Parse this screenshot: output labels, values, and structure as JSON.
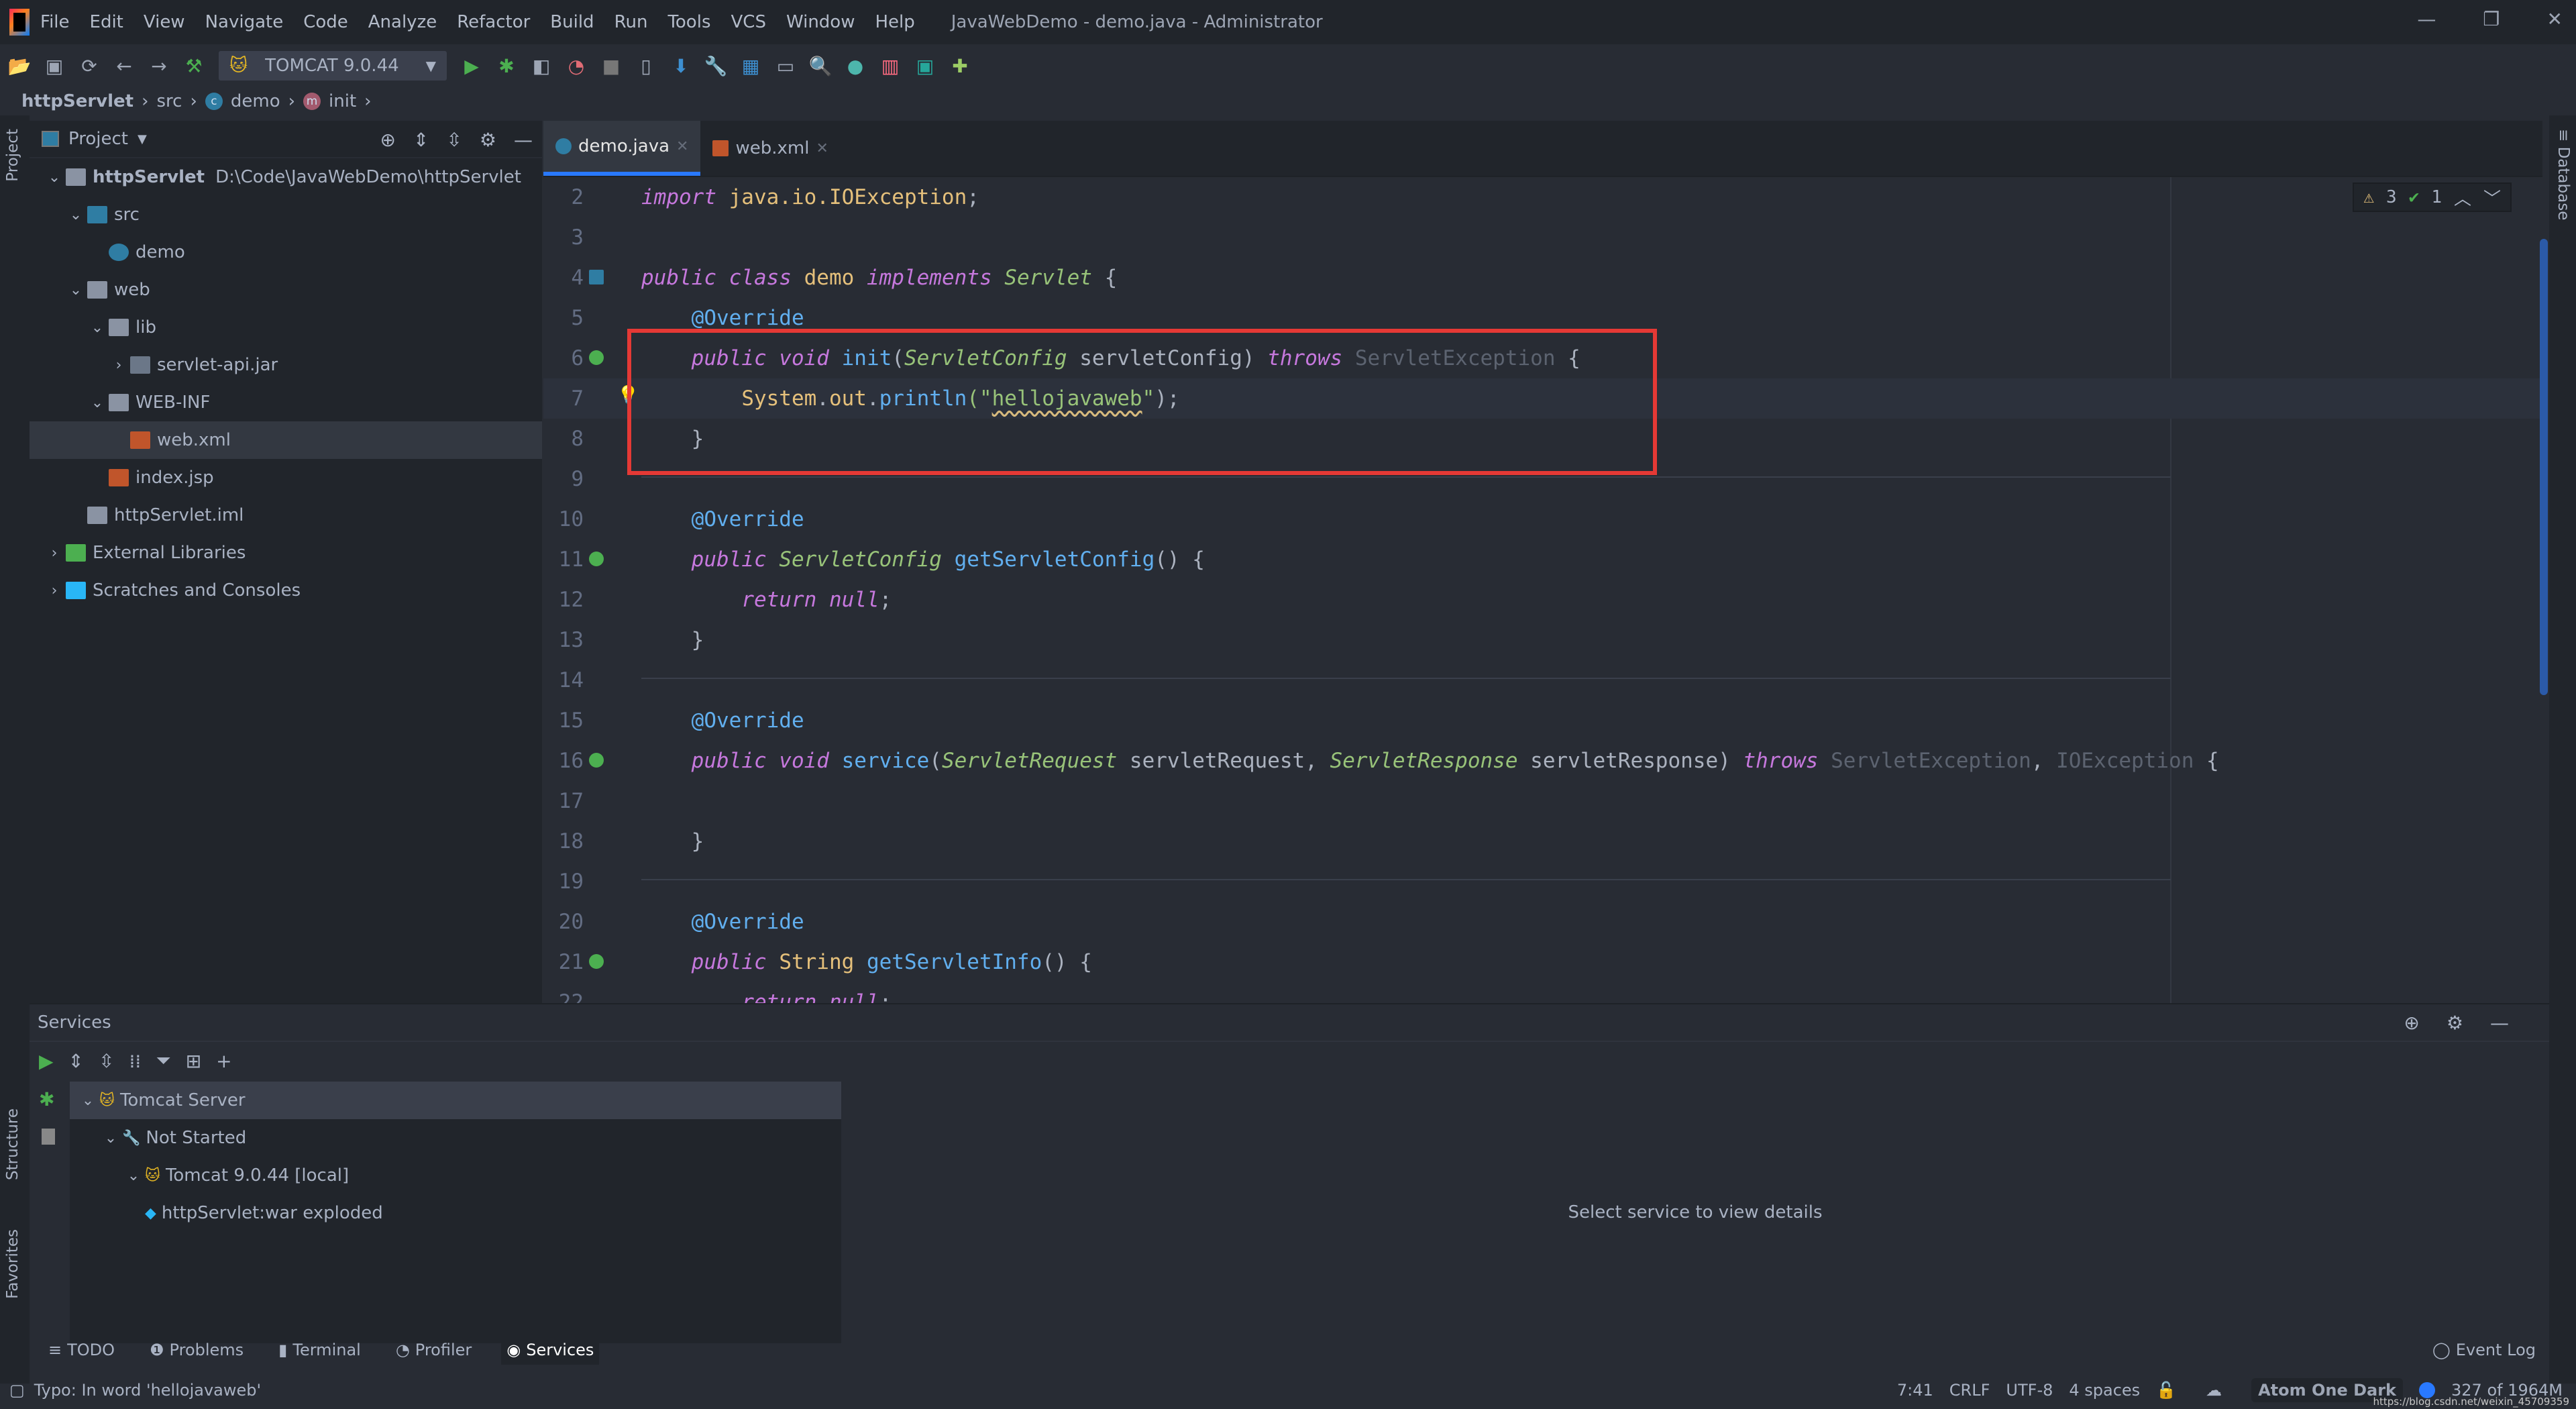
{
  "title_bar": {
    "menu": [
      "File",
      "Edit",
      "View",
      "Navigate",
      "Code",
      "Analyze",
      "Refactor",
      "Build",
      "Run",
      "Tools",
      "VCS",
      "Window",
      "Help"
    ],
    "window_title": "JavaWebDemo - demo.java - Administrator"
  },
  "toolbar": {
    "run_config": "TOMCAT 9.0.44"
  },
  "breadcrumb": [
    "httpServlet",
    "src",
    "demo",
    "init"
  ],
  "project_panel": {
    "title": "Project",
    "tree": [
      {
        "label": "httpServlet",
        "path": "D:\\Code\\JavaWebDemo\\httpServlet",
        "level": 0,
        "chevron": "down",
        "icon": "module-folder"
      },
      {
        "label": "src",
        "level": 1,
        "chevron": "down",
        "icon": "source-folder"
      },
      {
        "label": "demo",
        "level": 2,
        "chevron": "none",
        "icon": "java-class"
      },
      {
        "label": "web",
        "level": 1,
        "chevron": "down",
        "icon": "web-folder"
      },
      {
        "label": "lib",
        "level": 2,
        "chevron": "down",
        "icon": "folder"
      },
      {
        "label": "servlet-api.jar",
        "level": 3,
        "chevron": "right",
        "icon": "jar"
      },
      {
        "label": "WEB-INF",
        "level": 2,
        "chevron": "down",
        "icon": "folder"
      },
      {
        "label": "web.xml",
        "level": 3,
        "chevron": "none",
        "icon": "xml-file",
        "selected": true
      },
      {
        "label": "index.jsp",
        "level": 2,
        "chevron": "none",
        "icon": "jsp-file"
      },
      {
        "label": "httpServlet.iml",
        "level": 1,
        "chevron": "none",
        "icon": "iml-file"
      },
      {
        "label": "External Libraries",
        "level": 0,
        "chevron": "right",
        "icon": "libraries"
      },
      {
        "label": "Scratches and Consoles",
        "level": 0,
        "chevron": "right",
        "icon": "scratches"
      }
    ]
  },
  "left_stripe": {
    "project": "Project",
    "structure": "Structure",
    "favorites": "Favorites"
  },
  "right_stripe": {
    "database": "Database"
  },
  "editor": {
    "tabs": [
      {
        "label": "demo.java",
        "active": true
      },
      {
        "label": "web.xml",
        "active": false
      }
    ],
    "inspections": {
      "warnings": "3",
      "typos": "1"
    },
    "current_line": 7,
    "lines": [
      {
        "n": "2",
        "tokens": [
          [
            "import",
            "kw"
          ],
          [
            " java.io.IOException",
            "yl"
          ],
          [
            ";",
            "pl"
          ]
        ]
      },
      {
        "n": "3",
        "tokens": []
      },
      {
        "n": "4",
        "tokens": [
          [
            "public class ",
            "kw"
          ],
          [
            "demo ",
            "cn"
          ],
          [
            "implements ",
            "kw"
          ],
          [
            "Servlet",
            "ty"
          ],
          [
            " {",
            "pl"
          ]
        ]
      },
      {
        "n": "5",
        "tokens": [
          [
            "    ",
            "pl"
          ],
          [
            "@Override",
            "an"
          ]
        ]
      },
      {
        "n": "6",
        "tokens": [
          [
            "    ",
            "pl"
          ],
          [
            "public void ",
            "kw"
          ],
          [
            "init",
            "fn"
          ],
          [
            "(",
            "pl"
          ],
          [
            "ServletConfig",
            "ty"
          ],
          [
            " servletConfig) ",
            "pl"
          ],
          [
            "throws ",
            "kw"
          ],
          [
            "ServletException",
            "dim"
          ],
          [
            " {",
            "pl"
          ]
        ]
      },
      {
        "n": "7",
        "tokens": [
          [
            "        ",
            "pl"
          ],
          [
            "System",
            "yl"
          ],
          [
            ".",
            "pl"
          ],
          [
            "out",
            "yl"
          ],
          [
            ".",
            "pl"
          ],
          [
            "println",
            "fn"
          ],
          [
            "(\"",
            "st"
          ],
          [
            "hellojavaweb",
            "st typo"
          ],
          [
            "\"",
            "st"
          ],
          [
            ");",
            "pl"
          ]
        ]
      },
      {
        "n": "8",
        "tokens": [
          [
            "    }",
            "pl"
          ]
        ]
      },
      {
        "n": "9",
        "tokens": []
      },
      {
        "n": "10",
        "tokens": [
          [
            "    ",
            "pl"
          ],
          [
            "@Override",
            "an"
          ]
        ]
      },
      {
        "n": "11",
        "tokens": [
          [
            "    ",
            "pl"
          ],
          [
            "public ",
            "kw"
          ],
          [
            "ServletConfig",
            "ty"
          ],
          [
            " ",
            "pl"
          ],
          [
            "getServletConfig",
            "fn"
          ],
          [
            "() {",
            "pl"
          ]
        ]
      },
      {
        "n": "12",
        "tokens": [
          [
            "        ",
            "pl"
          ],
          [
            "return null",
            "kw"
          ],
          [
            ";",
            "pl"
          ]
        ]
      },
      {
        "n": "13",
        "tokens": [
          [
            "    }",
            "pl"
          ]
        ]
      },
      {
        "n": "14",
        "tokens": []
      },
      {
        "n": "15",
        "tokens": [
          [
            "    ",
            "pl"
          ],
          [
            "@Override",
            "an"
          ]
        ]
      },
      {
        "n": "16",
        "tokens": [
          [
            "    ",
            "pl"
          ],
          [
            "public void ",
            "kw"
          ],
          [
            "service",
            "fn"
          ],
          [
            "(",
            "pl"
          ],
          [
            "ServletRequest",
            "ty"
          ],
          [
            " servletRequest, ",
            "pl"
          ],
          [
            "ServletResponse",
            "ty"
          ],
          [
            " servletResponse) ",
            "pl"
          ],
          [
            "throws ",
            "kw"
          ],
          [
            "ServletException",
            "dim"
          ],
          [
            ", ",
            "pl"
          ],
          [
            "IOException",
            "dim"
          ],
          [
            " {",
            "pl"
          ]
        ]
      },
      {
        "n": "17",
        "tokens": []
      },
      {
        "n": "18",
        "tokens": [
          [
            "    }",
            "pl"
          ]
        ]
      },
      {
        "n": "19",
        "tokens": []
      },
      {
        "n": "20",
        "tokens": [
          [
            "    ",
            "pl"
          ],
          [
            "@Override",
            "an"
          ]
        ]
      },
      {
        "n": "21",
        "tokens": [
          [
            "    ",
            "pl"
          ],
          [
            "public ",
            "kw"
          ],
          [
            "String",
            "yl"
          ],
          [
            " ",
            "pl"
          ],
          [
            "getServletInfo",
            "fn"
          ],
          [
            "() {",
            "pl"
          ]
        ]
      },
      {
        "n": "22",
        "tokens": [
          [
            "        ",
            "pl"
          ],
          [
            "return null",
            "kw"
          ],
          [
            ";",
            "pl"
          ]
        ]
      }
    ]
  },
  "services": {
    "title": "Services",
    "tree": [
      {
        "label": "Tomcat Server",
        "level": 0,
        "selected": true
      },
      {
        "label": "Not Started",
        "level": 1
      },
      {
        "label": "Tomcat 9.0.44 [local]",
        "level": 2
      },
      {
        "label": "httpServlet:war exploded",
        "level": 3
      }
    ],
    "detail_placeholder": "Select service to view details"
  },
  "bottom_tabs": [
    {
      "label": "TODO"
    },
    {
      "label": "Problems"
    },
    {
      "label": "Terminal"
    },
    {
      "label": "Profiler"
    },
    {
      "label": "Services",
      "active": true
    }
  ],
  "event_log": "Event Log",
  "status_bar": {
    "message": "Typo: In word 'hellojavaweb'",
    "position": "7:41",
    "line_sep": "CRLF",
    "encoding": "UTF-8",
    "indent": "4 spaces",
    "theme": "Atom One Dark",
    "memory": "327 of 1964M"
  },
  "watermark": "https://blog.csdn.net/weixin_45709359",
  "colors": {
    "accent": "#2979ff",
    "highlight_box": "#e53935",
    "run_green": "#4caf50"
  }
}
